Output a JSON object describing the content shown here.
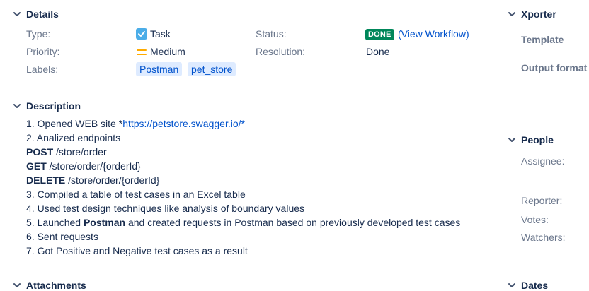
{
  "details": {
    "title": "Details",
    "type_label": "Type:",
    "type_value": "Task",
    "priority_label": "Priority:",
    "priority_value": "Medium",
    "labels_label": "Labels:",
    "labels": [
      "Postman",
      "pet_store"
    ],
    "status_label": "Status:",
    "status_value": "DONE",
    "view_workflow": "(View Workflow)",
    "resolution_label": "Resolution:",
    "resolution_value": "Done"
  },
  "description": {
    "title": "Description",
    "line1_prefix": "1. Opened WEB site *",
    "line1_link": "https://petstore.swagger.io/*",
    "line2": "2. Analized endpoints",
    "post_method": "POST",
    "post_path": " /store/order",
    "get_method": "GET",
    "get_path": " /store/order/{orderId}",
    "delete_method": "DELETE",
    "delete_path": " /store/order/{orderId}",
    "line3": "3. Compiled a table of test cases in an Excel table",
    "line4": "4. Used test design techniques like analysis of boundary values",
    "line5_prefix": "5. Launched ",
    "line5_bold": "Postman",
    "line5_suffix": " and created requests in Postman based on previously developed test cases",
    "line6": "6. Sent requests",
    "line7": "7. Got Positive and Negative test cases as a result"
  },
  "attachments": {
    "title": "Attachments"
  },
  "xporter": {
    "title": "Xporter",
    "template_label": "Template",
    "output_format_label": "Output format"
  },
  "people": {
    "title": "People",
    "assignee_label": "Assignee:",
    "reporter_label": "Reporter:",
    "votes_label": "Votes:",
    "watchers_label": "Watchers:"
  },
  "dates": {
    "title": "Dates"
  },
  "colors": {
    "link": "#0052cc",
    "done_lozenge": "#00875a",
    "label_bg": "#deebff",
    "priority_medium": "#ffab00",
    "task_icon": "#4bade8"
  }
}
